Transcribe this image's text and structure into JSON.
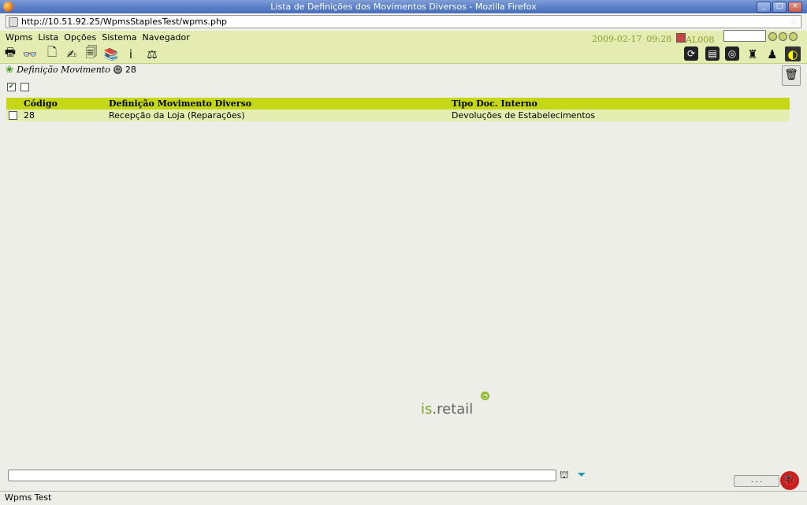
{
  "window": {
    "title": "Lista de Definições dos Movimentos Diversos - Mozilla Firefox"
  },
  "browser": {
    "url": "http://10.51.92.25/WpmsStaplesTest/wpms.php"
  },
  "menu": {
    "items": [
      "Wpms",
      "Lista",
      "Opções",
      "Sistema",
      "Navegador"
    ]
  },
  "session": {
    "date": "2009-02-17",
    "time": "09:28",
    "user": "AL008"
  },
  "toolbar": {
    "left_icons": [
      "printer-icon",
      "binoculars-icon",
      "new-document-icon",
      "edit-icon",
      "copy-document-icon",
      "files-icon",
      "info-icon",
      "scale-icon"
    ],
    "right_icons": [
      "refresh-icon",
      "save-icon",
      "lifebuoy-icon",
      "stamp-icon",
      "user-icon",
      "exit-icon"
    ]
  },
  "section": {
    "title": "Definição Movimento",
    "count": "28"
  },
  "table": {
    "headers": [
      "Código",
      "Definição Movimento Diverso",
      "Tipo Doc. Interno"
    ],
    "rows": [
      {
        "codigo": "28",
        "definicao": "Recepção da Loja (Reparações)",
        "tipo": "Devoluções de Estabelecimentos"
      }
    ]
  },
  "logo": {
    "part1": "is",
    "part2": ".retail"
  },
  "footer": {
    "dots_button": ". . ."
  },
  "status": {
    "text": "Wpms Test"
  },
  "colors": {
    "title_bar": "#5a7fc8",
    "menu_bg": "#e4ecb2",
    "table_header": "#c4d817",
    "row_bg": "#e6edb0"
  }
}
